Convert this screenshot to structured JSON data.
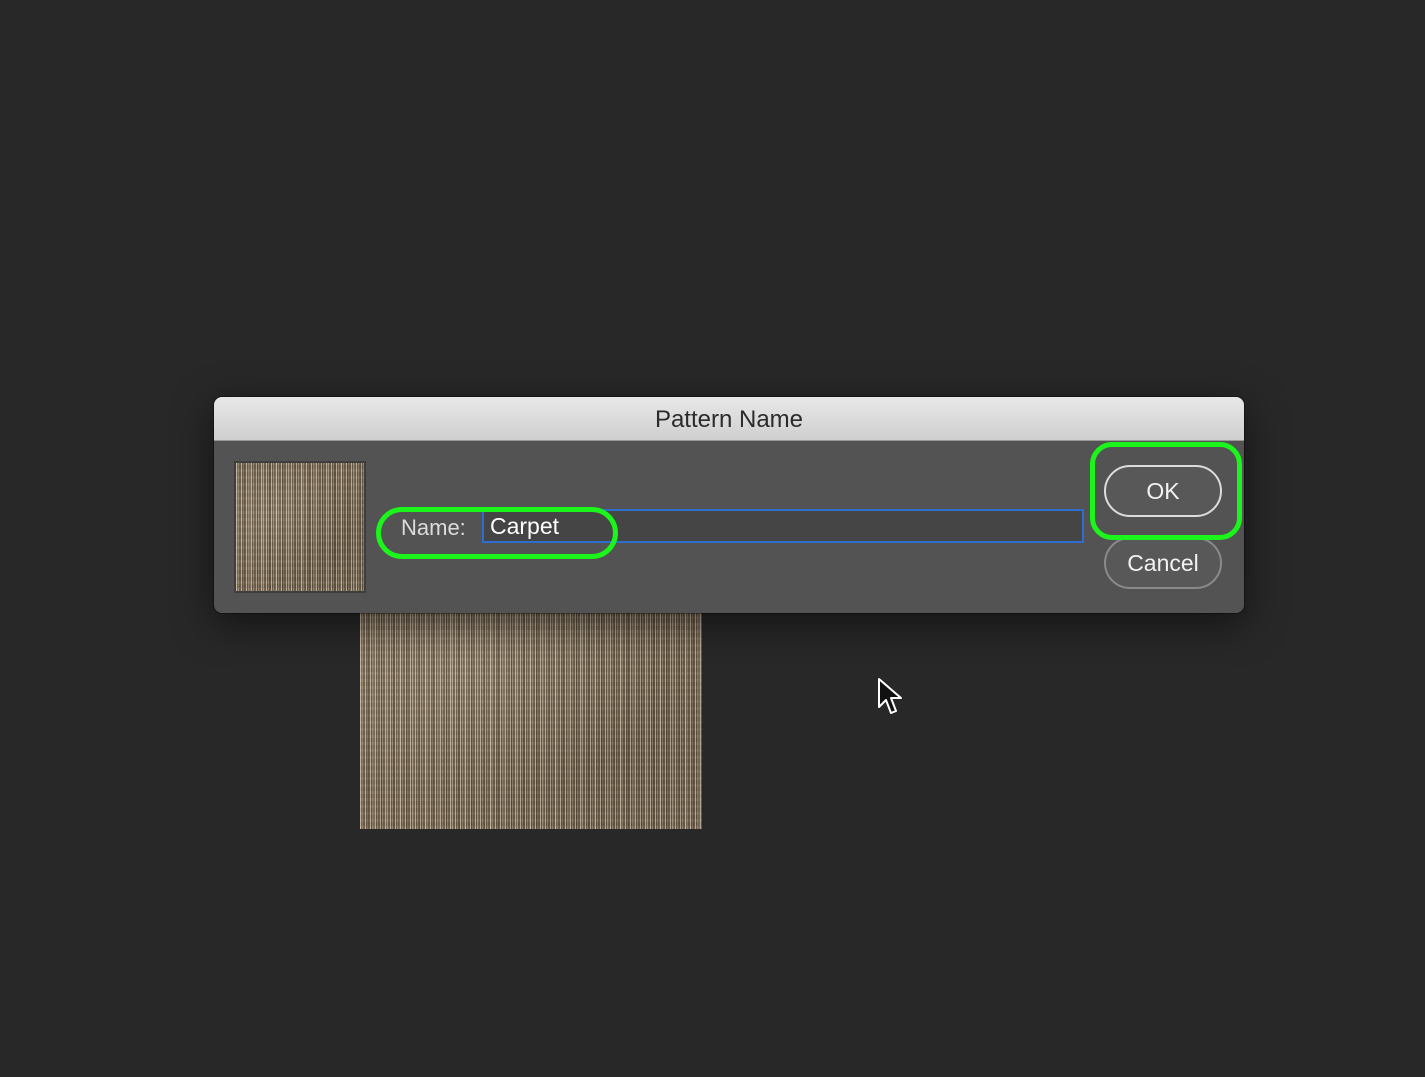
{
  "dialog": {
    "title": "Pattern Name",
    "name_label": "Name:",
    "name_value": "Carpet",
    "ok_label": "OK",
    "cancel_label": "Cancel"
  },
  "preview": {
    "thumbnail": "carpet-pattern-thumbnail",
    "document_image": "carpet-texture-image"
  },
  "colors": {
    "background": "#282828",
    "dialog_body": "#535353",
    "titlebar": "#d9d9d9",
    "focus_ring": "#2f6ecf",
    "highlight": "#1bf51b"
  },
  "cursor": "arrow-pointer-icon"
}
